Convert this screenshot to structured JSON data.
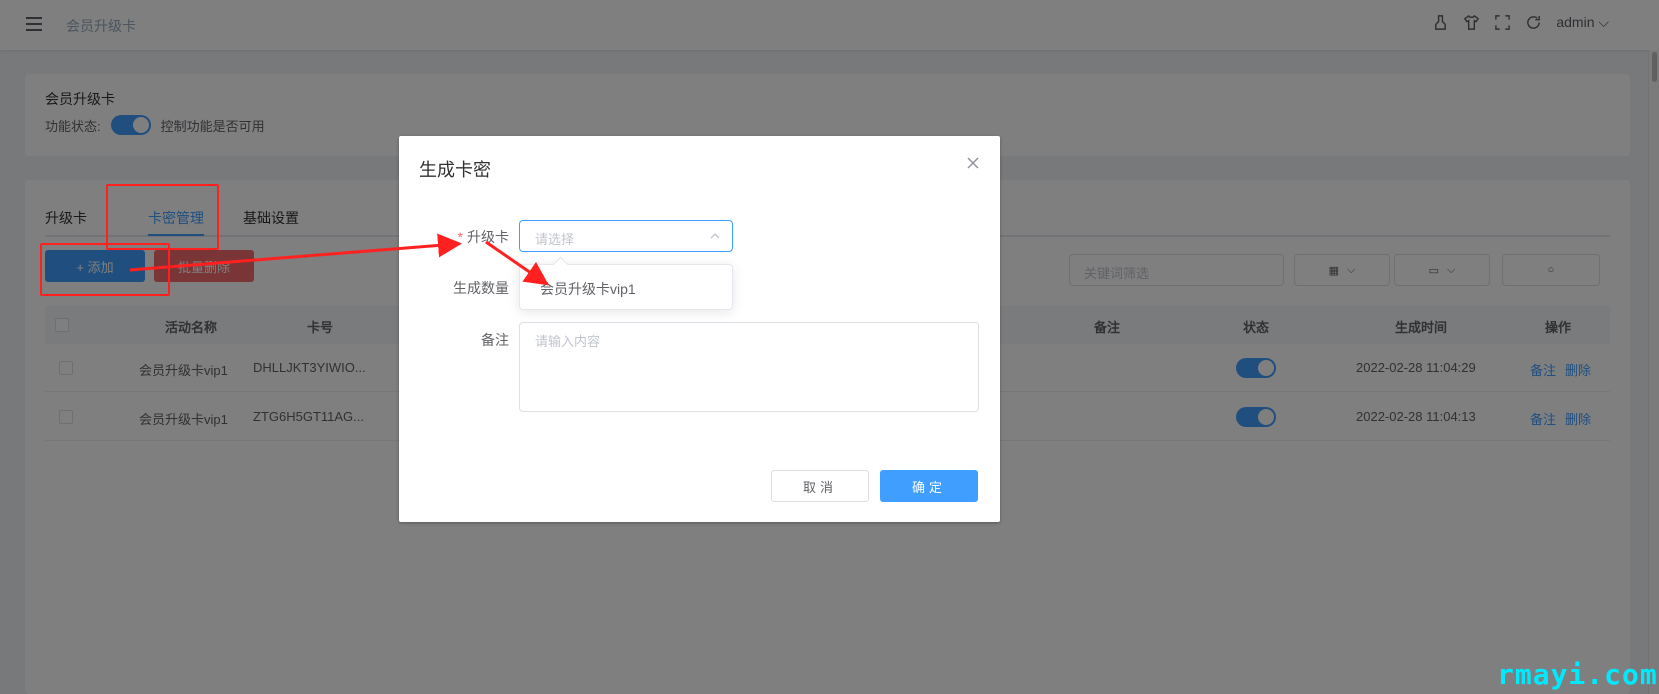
{
  "topbar": {
    "title": "会员升级卡",
    "user": "admin"
  },
  "feature_card": {
    "title": "会员升级卡",
    "status_label": "功能状态:",
    "status_desc": "控制功能是否可用",
    "enabled": true
  },
  "tabs": [
    {
      "label": "升级卡"
    },
    {
      "label": "卡密管理"
    },
    {
      "label": "基础设置"
    }
  ],
  "toolbar": {
    "add_label": "+ 添加",
    "batch_delete_label": "批量删除",
    "keyword_placeholder": "关键词筛选"
  },
  "table": {
    "columns": [
      "活动名称",
      "卡号",
      "备注",
      "状态",
      "生成时间",
      "操作"
    ],
    "rows": [
      {
        "name": "会员升级卡vip1",
        "card_no": "DHLLJKT3YIWIO...",
        "remark": "",
        "status_on": true,
        "time": "2022-02-28 11:04:29",
        "action_remark": "备注",
        "action_delete": "删除"
      },
      {
        "name": "会员升级卡vip1",
        "card_no": "ZTG6H5GT11AG...",
        "remark": "",
        "status_on": true,
        "time": "2022-02-28 11:04:13",
        "action_remark": "备注",
        "action_delete": "删除"
      }
    ]
  },
  "dialog": {
    "title": "生成卡密",
    "upgrade_label": "升级卡",
    "required_mark": "*",
    "select_placeholder": "请选择",
    "quantity_label": "生成数量",
    "remark_label": "备注",
    "remark_placeholder": "请输入内容",
    "dropdown_options": [
      "会员升级卡vip1"
    ],
    "cancel_label": "取消",
    "confirm_label": "确定"
  },
  "watermark": "rmayi.com",
  "colors": {
    "primary": "#409eff",
    "danger": "#f56c6c",
    "annotation": "#ff2020",
    "watermark": "#00eaff"
  }
}
